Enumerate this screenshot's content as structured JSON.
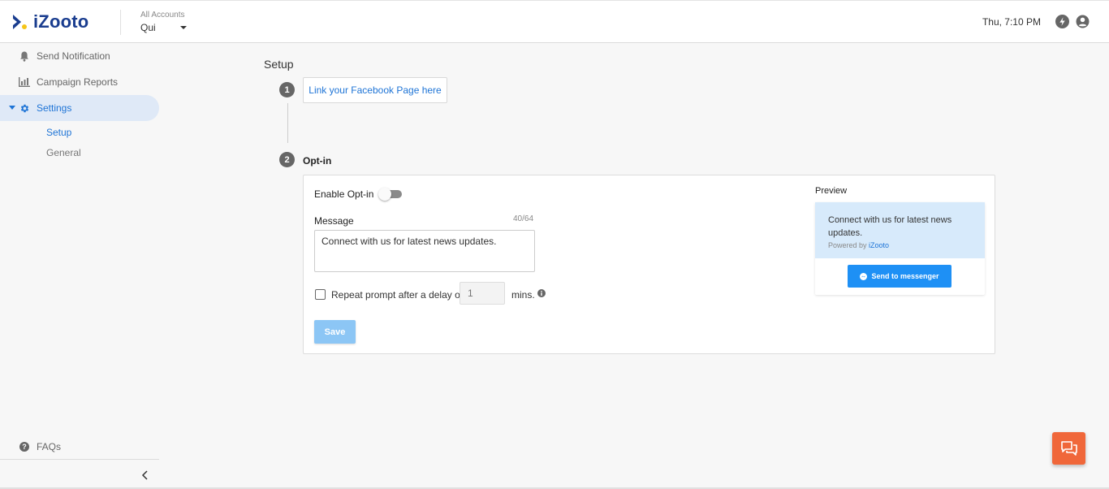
{
  "header": {
    "brand": "iZooto",
    "account_label": "All Accounts",
    "account_value": "Qui",
    "time": "Thu, 7:10 PM"
  },
  "sidebar": {
    "items": [
      {
        "label": "Send Notification",
        "icon": "bell-icon"
      },
      {
        "label": "Campaign Reports",
        "icon": "bar-chart-icon"
      },
      {
        "label": "Settings",
        "icon": "gear-icon",
        "active": true
      }
    ],
    "sub_items": [
      {
        "label": "Setup",
        "active": true
      },
      {
        "label": "General",
        "active": false
      }
    ],
    "faq_label": "FAQs"
  },
  "main": {
    "title": "Setup",
    "step1": {
      "number": "1",
      "button_label": "Link your Facebook Page here"
    },
    "step2": {
      "number": "2",
      "label": "Opt-in",
      "enable_label": "Enable Opt-in",
      "enable_on": false,
      "message_label": "Message",
      "message_count": "40/64",
      "message_value": "Connect with us for latest news updates.",
      "repeat_label": "Repeat prompt after a delay of",
      "repeat_checked": false,
      "delay_placeholder": "1",
      "mins_label": "mins.",
      "save_label": "Save"
    },
    "preview": {
      "label": "Preview",
      "message": "Connect with us for latest news updates.",
      "powered_prefix": "Powered by ",
      "powered_brand": "iZooto",
      "send_label": "Send to messenger"
    }
  },
  "colors": {
    "brand_navy": "#1a3d8f",
    "accent_blue": "#1e74d6",
    "save_disabled": "#8cc6f5",
    "send_button": "#1e90f5",
    "chat_fab": "#f0673a"
  }
}
